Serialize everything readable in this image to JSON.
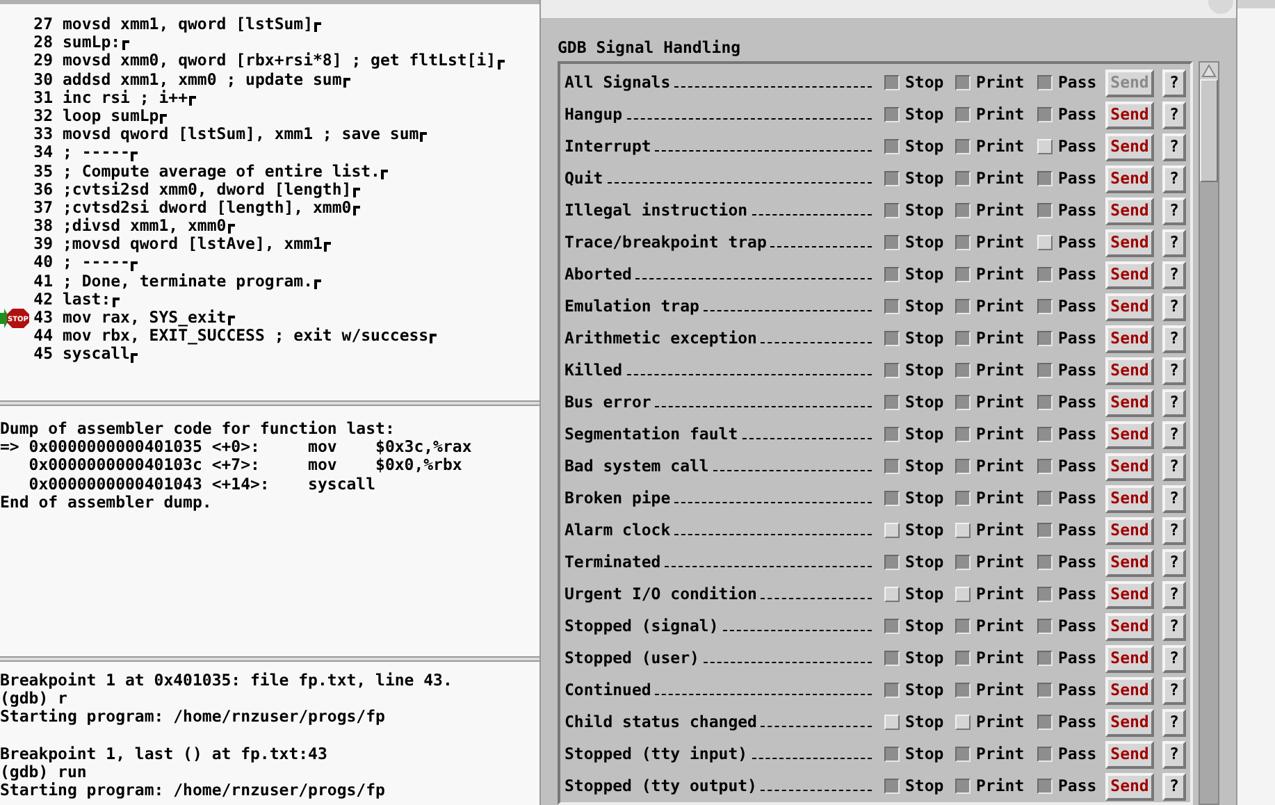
{
  "source_pane": {
    "show_eol_markers": true,
    "lines": [
      {
        "number": "27",
        "text": "movsd xmm1, qword [lstSum]",
        "kind": "plain"
      },
      {
        "number": "28",
        "text": "sumLp:",
        "kind": "plain"
      },
      {
        "number": "29",
        "text": "movsd xmm0, qword [rbx+rsi*8] ; get fltLst[i]",
        "kind": "plain"
      },
      {
        "number": "30",
        "text": "addsd xmm1, xmm0 ; update sum",
        "kind": "plain"
      },
      {
        "number": "31",
        "text": "inc rsi ; i++",
        "kind": "plain"
      },
      {
        "number": "32",
        "text": "loop sumLp",
        "kind": "plain"
      },
      {
        "number": "33",
        "text": "movsd qword [lstSum], xmm1 ; save sum",
        "kind": "plain"
      },
      {
        "number": "34",
        "text": "; -----",
        "kind": "plain"
      },
      {
        "number": "35",
        "text": "; Compute average of entire list.",
        "kind": "plain"
      },
      {
        "number": "36",
        "text": ";cvtsi2sd xmm0, dword [length]",
        "kind": "plain"
      },
      {
        "number": "37",
        "text": ";cvtsd2si dword [length], xmm0",
        "kind": "plain"
      },
      {
        "number": "38",
        "text": ";divsd xmm1, xmm0",
        "kind": "plain"
      },
      {
        "number": "39",
        "text": ";movsd qword [lstAve], xmm1",
        "kind": "plain"
      },
      {
        "number": "40",
        "text": "; -----",
        "kind": "plain"
      },
      {
        "number": "41",
        "text": "; Done, terminate program.",
        "kind": "plain"
      },
      {
        "number": "42",
        "text": "last:",
        "kind": "plain"
      },
      {
        "number": "43",
        "text": "mov rax, SYS_exit",
        "kind": "current_breakpoint",
        "marker_label": "STOP"
      },
      {
        "number": "44",
        "text": "mov rbx, EXIT_SUCCESS ; exit w/success",
        "kind": "plain"
      },
      {
        "number": "45",
        "text": "syscall",
        "kind": "plain"
      }
    ]
  },
  "disassembly_pane": {
    "lines": [
      "Dump of assembler code for function last:",
      "=> 0x0000000000401035 <+0>:     mov    $0x3c,%rax",
      "   0x000000000040103c <+7>:     mov    $0x0,%rbx",
      "   0x0000000000401043 <+14>:    syscall",
      "End of assembler dump."
    ]
  },
  "console_pane": {
    "blocks": [
      [
        "Breakpoint 1 at 0x401035: file fp.txt, line 43.",
        "(gdb) r",
        "Starting program: /home/rnzuser/progs/fp"
      ],
      [
        "Breakpoint 1, last () at fp.txt:43",
        "(gdb) run",
        "Starting program: /home/rnzuser/progs/fp"
      ]
    ]
  },
  "signal_dialog": {
    "heading": "GDB Signal Handling",
    "rows": [
      {
        "name": "All Signals",
        "stop": true,
        "print": true,
        "pass": true,
        "labels": [
          "Stop",
          "Print",
          "Pass"
        ],
        "send": "Send",
        "send_disabled": true,
        "help": "?"
      },
      {
        "name": "Hangup",
        "stop": true,
        "print": true,
        "pass": true,
        "labels": [
          "Stop",
          "Print",
          "Pass"
        ],
        "send": "Send",
        "send_disabled": false,
        "help": "?"
      },
      {
        "name": "Interrupt",
        "stop": true,
        "print": true,
        "pass": false,
        "labels": [
          "Stop",
          "Print",
          "Pass"
        ],
        "send": "Send",
        "send_disabled": false,
        "help": "?"
      },
      {
        "name": "Quit",
        "stop": true,
        "print": true,
        "pass": true,
        "labels": [
          "Stop",
          "Print",
          "Pass"
        ],
        "send": "Send",
        "send_disabled": false,
        "help": "?"
      },
      {
        "name": "Illegal instruction",
        "stop": true,
        "print": true,
        "pass": true,
        "labels": [
          "Stop",
          "Print",
          "Pass"
        ],
        "send": "Send",
        "send_disabled": false,
        "help": "?"
      },
      {
        "name": "Trace/breakpoint trap",
        "stop": true,
        "print": true,
        "pass": false,
        "labels": [
          "Stop",
          "Print",
          "Pass"
        ],
        "send": "Send",
        "send_disabled": false,
        "help": "?"
      },
      {
        "name": "Aborted",
        "stop": true,
        "print": true,
        "pass": true,
        "labels": [
          "Stop",
          "Print",
          "Pass"
        ],
        "send": "Send",
        "send_disabled": false,
        "help": "?"
      },
      {
        "name": "Emulation trap",
        "stop": true,
        "print": true,
        "pass": true,
        "labels": [
          "Stop",
          "Print",
          "Pass"
        ],
        "send": "Send",
        "send_disabled": false,
        "help": "?"
      },
      {
        "name": "Arithmetic exception",
        "stop": true,
        "print": true,
        "pass": true,
        "labels": [
          "Stop",
          "Print",
          "Pass"
        ],
        "send": "Send",
        "send_disabled": false,
        "help": "?"
      },
      {
        "name": "Killed",
        "stop": true,
        "print": true,
        "pass": true,
        "labels": [
          "Stop",
          "Print",
          "Pass"
        ],
        "send": "Send",
        "send_disabled": false,
        "help": "?"
      },
      {
        "name": "Bus error",
        "stop": true,
        "print": true,
        "pass": true,
        "labels": [
          "Stop",
          "Print",
          "Pass"
        ],
        "send": "Send",
        "send_disabled": false,
        "help": "?"
      },
      {
        "name": "Segmentation fault",
        "stop": true,
        "print": true,
        "pass": true,
        "labels": [
          "Stop",
          "Print",
          "Pass"
        ],
        "send": "Send",
        "send_disabled": false,
        "help": "?"
      },
      {
        "name": "Bad system call",
        "stop": true,
        "print": true,
        "pass": true,
        "labels": [
          "Stop",
          "Print",
          "Pass"
        ],
        "send": "Send",
        "send_disabled": false,
        "help": "?"
      },
      {
        "name": "Broken pipe",
        "stop": true,
        "print": true,
        "pass": true,
        "labels": [
          "Stop",
          "Print",
          "Pass"
        ],
        "send": "Send",
        "send_disabled": false,
        "help": "?"
      },
      {
        "name": "Alarm clock",
        "stop": false,
        "print": false,
        "pass": true,
        "labels": [
          "Stop",
          "Print",
          "Pass"
        ],
        "send": "Send",
        "send_disabled": false,
        "help": "?"
      },
      {
        "name": "Terminated",
        "stop": true,
        "print": true,
        "pass": true,
        "labels": [
          "Stop",
          "Print",
          "Pass"
        ],
        "send": "Send",
        "send_disabled": false,
        "help": "?"
      },
      {
        "name": "Urgent I/O condition",
        "stop": false,
        "print": false,
        "pass": true,
        "labels": [
          "Stop",
          "Print",
          "Pass"
        ],
        "send": "Send",
        "send_disabled": false,
        "help": "?"
      },
      {
        "name": "Stopped (signal)",
        "stop": true,
        "print": true,
        "pass": true,
        "labels": [
          "Stop",
          "Print",
          "Pass"
        ],
        "send": "Send",
        "send_disabled": false,
        "help": "?"
      },
      {
        "name": "Stopped (user)",
        "stop": true,
        "print": true,
        "pass": true,
        "labels": [
          "Stop",
          "Print",
          "Pass"
        ],
        "send": "Send",
        "send_disabled": false,
        "help": "?"
      },
      {
        "name": "Continued",
        "stop": true,
        "print": true,
        "pass": true,
        "labels": [
          "Stop",
          "Print",
          "Pass"
        ],
        "send": "Send",
        "send_disabled": false,
        "help": "?"
      },
      {
        "name": "Child status changed",
        "stop": false,
        "print": false,
        "pass": true,
        "labels": [
          "Stop",
          "Print",
          "Pass"
        ],
        "send": "Send",
        "send_disabled": false,
        "help": "?"
      },
      {
        "name": "Stopped (tty input)",
        "stop": true,
        "print": true,
        "pass": true,
        "labels": [
          "Stop",
          "Print",
          "Pass"
        ],
        "send": "Send",
        "send_disabled": false,
        "help": "?"
      },
      {
        "name": "Stopped (tty output)",
        "stop": true,
        "print": true,
        "pass": true,
        "labels": [
          "Stop",
          "Print",
          "Pass"
        ],
        "send": "Send",
        "send_disabled": false,
        "help": "?"
      }
    ]
  }
}
